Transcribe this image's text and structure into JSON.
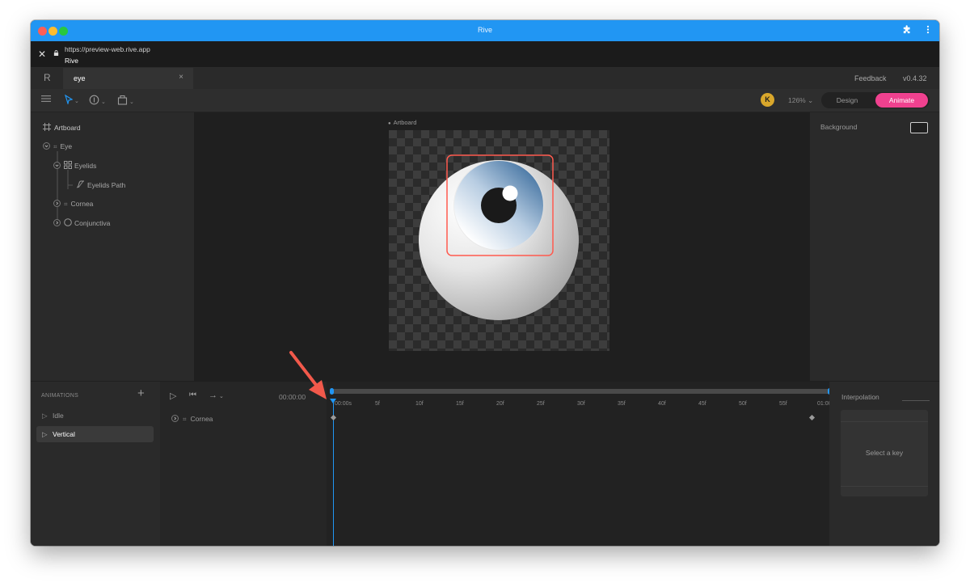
{
  "window": {
    "title": "Rive",
    "url": "https://preview-web.rive.app",
    "page_title": "Rive",
    "traffic_lights": [
      "#fc5f57",
      "#fdbc2e",
      "#28c840"
    ]
  },
  "tabs": {
    "logo": "R",
    "active_tab": "eye",
    "close_glyph": "×",
    "feedback": "Feedback",
    "version": "v0.4.32"
  },
  "toolbar": {
    "avatar_initial": "K",
    "zoom": "126%",
    "modes": {
      "design": "Design",
      "animate": "Animate"
    },
    "accent": "#f0418f"
  },
  "hierarchy": {
    "items": [
      {
        "label": "Artboard",
        "icon": "artboard-icon"
      },
      {
        "label": "Eye",
        "icon": "group-icon"
      },
      {
        "label": "Eyelids",
        "icon": "shape-icon"
      },
      {
        "label": "Eyelids Path",
        "icon": "path-icon"
      },
      {
        "label": "Cornea",
        "icon": "group-icon"
      },
      {
        "label": "Conjunctiva",
        "icon": "ellipse-icon"
      }
    ]
  },
  "canvas": {
    "artboard_label": "Artboard",
    "selection_color": "#ff5a4e"
  },
  "inspector": {
    "background_label": "Background"
  },
  "animations": {
    "title": "ANIMATIONS",
    "add_glyph": "+",
    "items": [
      {
        "label": "Idle",
        "selected": false
      },
      {
        "label": "Vertical",
        "selected": true
      }
    ]
  },
  "timeline": {
    "timecode": "00:00:00",
    "track": "Cornea",
    "ticks": [
      "00:00s",
      "5f",
      "10f",
      "15f",
      "20f",
      "25f",
      "30f",
      "35f",
      "40f",
      "45f",
      "50f",
      "55f",
      "01:00"
    ],
    "playhead_color": "#2196f3"
  },
  "interpolation": {
    "title": "Interpolation",
    "empty_message": "Select a key"
  }
}
